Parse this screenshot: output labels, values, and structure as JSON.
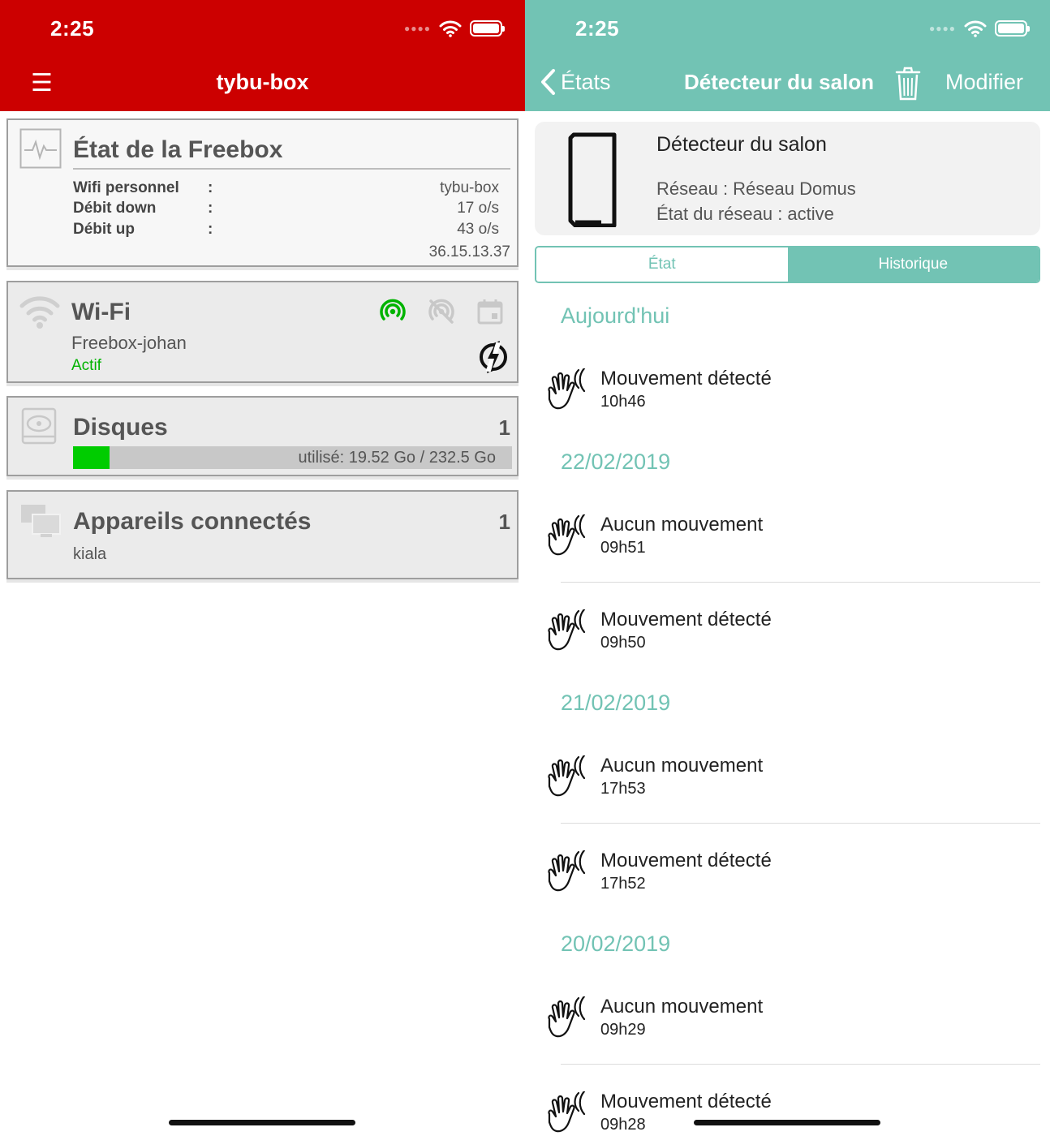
{
  "left": {
    "status_time": "2:25",
    "title": "tybu-box",
    "etat": {
      "title": "État de la Freebox",
      "rows": [
        {
          "label": "Wifi personnel",
          "sep": ":",
          "value": "tybu-box"
        },
        {
          "label": "Débit down",
          "sep": ":",
          "value": "17 o/s"
        },
        {
          "label": "Débit up",
          "sep": ":",
          "value": "43 o/s"
        }
      ],
      "ip": "36.15.13.37"
    },
    "wifi": {
      "title": "Wi-Fi",
      "ssid": "Freebox-johan",
      "state": "Actif",
      "active_color": "#00b300"
    },
    "disques": {
      "title": "Disques",
      "count": "1",
      "usage_text": "utilisé: 19.52 Go / 232.5 Go",
      "used_fraction": 0.084,
      "fill_color": "#00cc00"
    },
    "appareils": {
      "title": "Appareils connectés",
      "count": "1",
      "device": "kiala"
    },
    "brand_color": "#cc0000"
  },
  "right": {
    "status_time": "2:25",
    "back_label": "États",
    "title": "Détecteur du salon",
    "modify_label": "Modifier",
    "device": {
      "name": "Détecteur du salon",
      "network": "Réseau : Réseau Domus",
      "network_state": "État du réseau : active"
    },
    "tabs": [
      {
        "label": "État",
        "selected": false
      },
      {
        "label": "Historique",
        "selected": true
      }
    ],
    "history": [
      {
        "date": "Aujourd'hui",
        "events": [
          {
            "label": "Mouvement détecté",
            "time": "10h46"
          }
        ]
      },
      {
        "date": "22/02/2019",
        "events": [
          {
            "label": "Aucun mouvement",
            "time": "09h51"
          },
          {
            "label": "Mouvement détecté",
            "time": "09h50"
          }
        ]
      },
      {
        "date": "21/02/2019",
        "events": [
          {
            "label": "Aucun mouvement",
            "time": "17h53"
          },
          {
            "label": "Mouvement détecté",
            "time": "17h52"
          }
        ]
      },
      {
        "date": "20/02/2019",
        "events": [
          {
            "label": "Aucun mouvement",
            "time": "09h29"
          },
          {
            "label": "Mouvement détecté",
            "time": "09h28"
          }
        ]
      }
    ],
    "accent_color": "#72c3b4"
  }
}
